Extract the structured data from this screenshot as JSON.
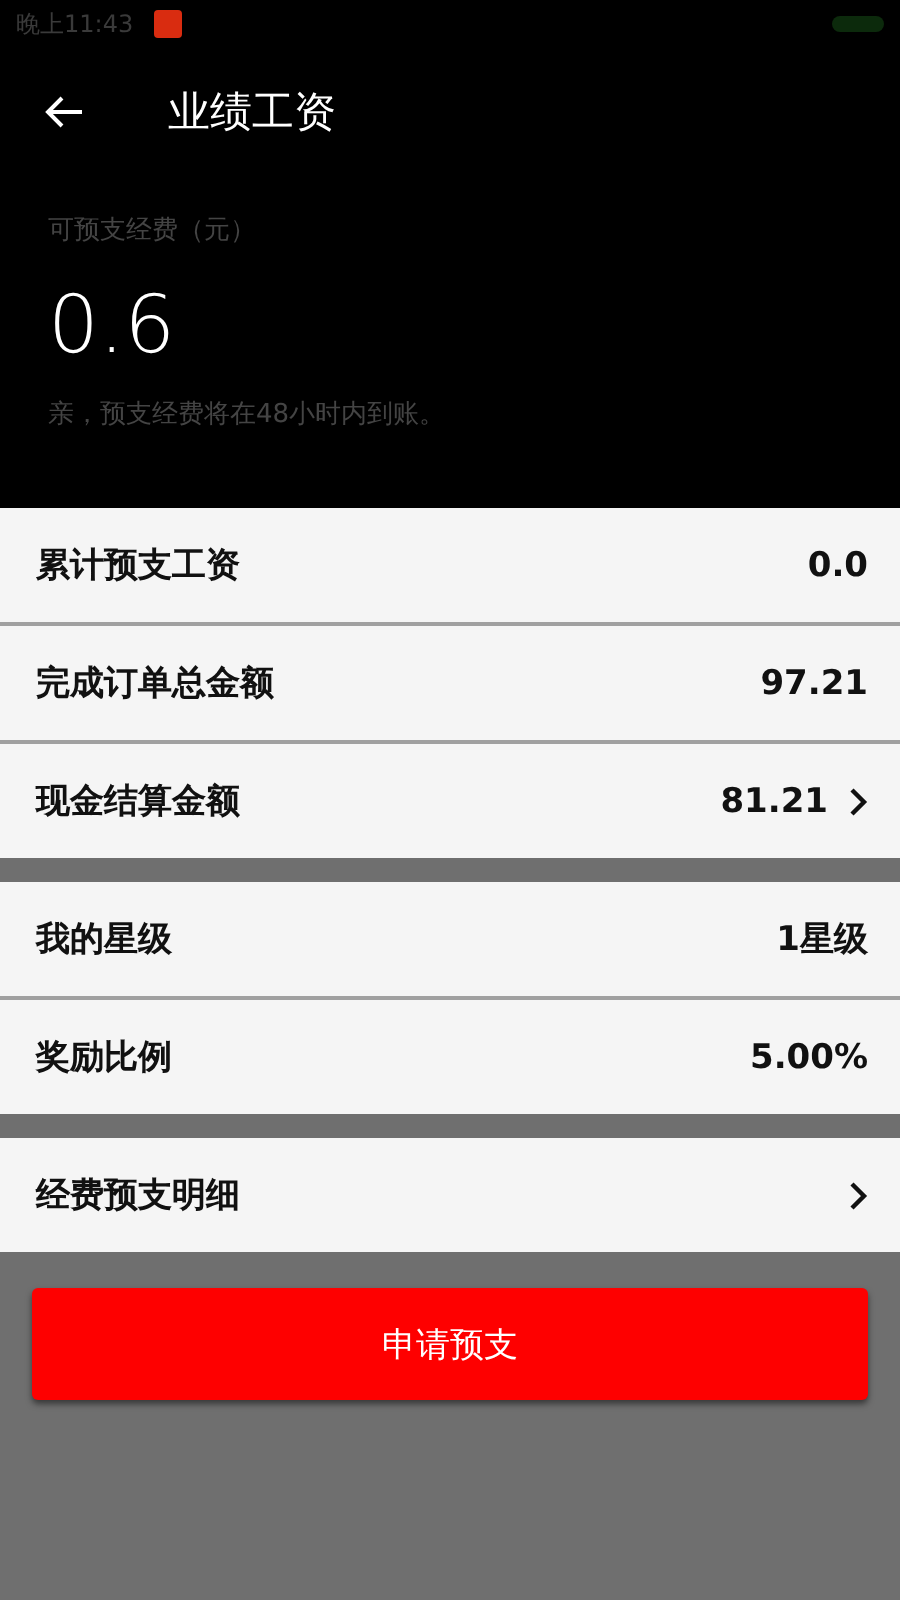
{
  "status_bar": {
    "time": "晚上11:43"
  },
  "header": {
    "title": "业绩工资"
  },
  "summary": {
    "label": "可预支经费（元）",
    "amount": "0.6",
    "note": "亲，预支经费将在48小时内到账。"
  },
  "groups": [
    {
      "rows": [
        {
          "label": "累计预支工资",
          "value": "0.0",
          "link": false
        },
        {
          "label": "完成订单总金额",
          "value": "97.21",
          "link": false
        },
        {
          "label": "现金结算金额",
          "value": "81.21",
          "link": true
        }
      ]
    },
    {
      "rows": [
        {
          "label": "我的星级",
          "value": "1星级",
          "link": false
        },
        {
          "label": "奖励比例",
          "value": "5.00%",
          "link": false
        }
      ]
    },
    {
      "rows": [
        {
          "label": "经费预支明细",
          "link": true
        }
      ]
    }
  ],
  "apply_button": {
    "label": "申请预支"
  }
}
